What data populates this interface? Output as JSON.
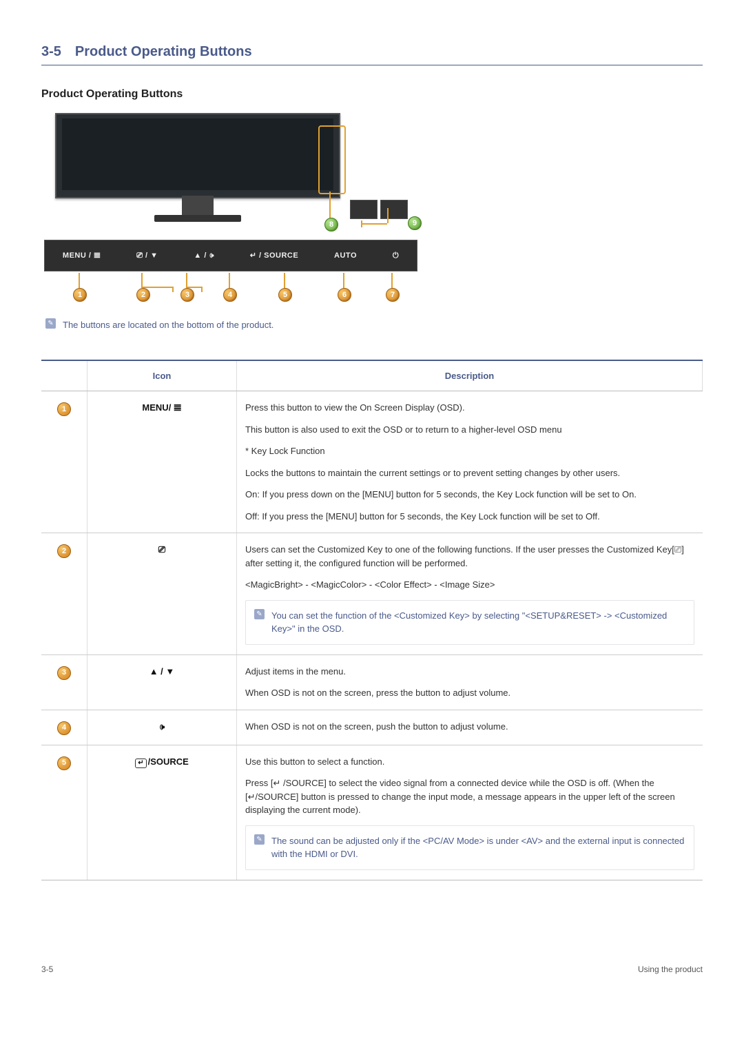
{
  "section": {
    "number": "3-5",
    "title": "Product Operating Buttons"
  },
  "subheading": "Product Operating Buttons",
  "button_bar": {
    "b1": "MENU / 𝌆",
    "b2": "⎚ / ▼",
    "b3": "▲ / 🕩",
    "b4": "↵ / SOURCE",
    "b5": "AUTO",
    "b6": "⏻"
  },
  "callout_numbers": {
    "c1": "1",
    "c2": "2",
    "c3": "3",
    "c4": "4",
    "c5": "5",
    "c6": "6",
    "c7": "7",
    "c8": "8",
    "c9": "9"
  },
  "note_top": "The buttons are located on the bottom of the product.",
  "table": {
    "head_icon": "Icon",
    "head_desc": "Description",
    "rows": [
      {
        "num": "1",
        "icon": "MENU/ 𝌆",
        "desc": [
          "Press this button to view the On Screen Display (OSD).",
          "This button is also used to exit the OSD or to return to a higher-level OSD menu",
          "* Key Lock Function",
          "Locks the buttons to maintain the current settings or to prevent setting changes by other users.",
          "On: If you press down on the [MENU] button for 5 seconds, the Key Lock function will be set to On.",
          "Off: If you press the [MENU] button for 5 seconds, the Key Lock function will be set to Off."
        ]
      },
      {
        "num": "2",
        "icon": "⎚",
        "desc": [
          "Users can set the Customized Key to one of the following functions. If the user presses the Customized Key[⎚] after setting it, the configured function will be performed.",
          "<MagicBright> - <MagicColor> - <Color Effect> - <Image Size>"
        ],
        "note": "You can set the function of the <Customized Key> by selecting \"<SETUP&RESET> -> <Customized Key>\" in the OSD."
      },
      {
        "num": "3",
        "icon": "▲ / ▼",
        "desc": [
          "Adjust items in the menu.",
          "When OSD is not on the screen, press the button to adjust volume."
        ]
      },
      {
        "num": "4",
        "icon": "🕩",
        "desc": [
          "When OSD is not on the screen, push the button to adjust volume."
        ]
      },
      {
        "num": "5",
        "icon": "↵ /SOURCE",
        "desc": [
          "Use this button to select a function.",
          "Press [↵ /SOURCE] to select the video signal from a connected device while the OSD is off. (When the [↵/SOURCE] button is pressed to change the input mode, a message appears in the upper left of the screen displaying the current mode)."
        ],
        "note": "The sound can be adjusted only if the <PC/AV Mode> is under <AV> and the external input is connected with the HDMI or DVI."
      }
    ]
  },
  "footer": {
    "left": "3-5",
    "right": "Using the product"
  }
}
